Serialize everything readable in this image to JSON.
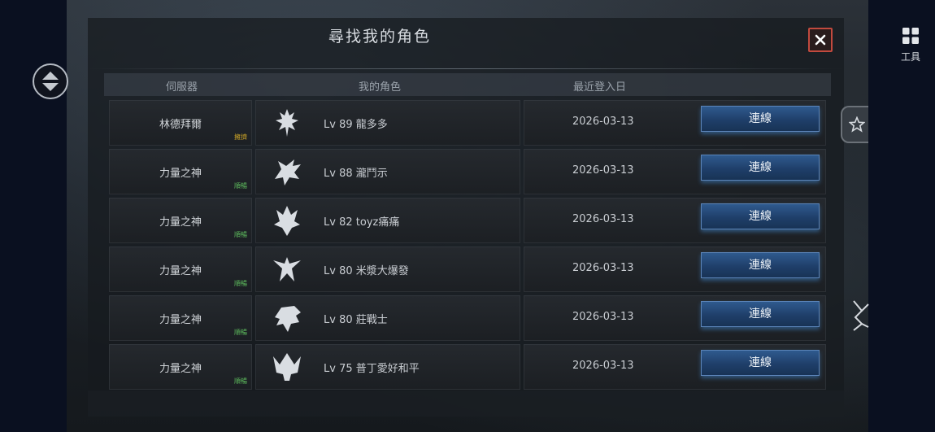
{
  "dialog": {
    "title": "尋找我的角色",
    "close_label": "close"
  },
  "table": {
    "headers": {
      "server": "伺服器",
      "character": "我的角色",
      "last_login": "最近登入日"
    },
    "rows": [
      {
        "server": "林德拜爾",
        "server_tag": "擁擠",
        "server_tag_color": "#c9a227",
        "level": "Lv 89",
        "name": "龍多多",
        "date": "2026-03-13",
        "button": "連線",
        "emblem": "spider-emblem-icon"
      },
      {
        "server": "力量之神",
        "server_tag": "順暢",
        "server_tag_color": "#5cb85c",
        "level": "Lv 88",
        "name": "瀧鬥示",
        "date": "2026-03-13",
        "button": "連線",
        "emblem": "wolf-emblem-icon"
      },
      {
        "server": "力量之神",
        "server_tag": "順暢",
        "server_tag_color": "#5cb85c",
        "level": "Lv 82",
        "name": "toyz痛痛",
        "date": "2026-03-13",
        "button": "連線",
        "emblem": "flame-emblem-icon"
      },
      {
        "server": "力量之神",
        "server_tag": "順暢",
        "server_tag_color": "#5cb85c",
        "level": "Lv 80",
        "name": "米漿大爆發",
        "date": "2026-03-13",
        "button": "連線",
        "emblem": "winged-emblem-icon"
      },
      {
        "server": "力量之神",
        "server_tag": "順暢",
        "server_tag_color": "#5cb85c",
        "level": "Lv 80",
        "name": "莊戰士",
        "date": "2026-03-13",
        "button": "連線",
        "emblem": "helmet-emblem-icon"
      },
      {
        "server": "力量之神",
        "server_tag": "順暢",
        "server_tag_color": "#5cb85c",
        "level": "Lv 75",
        "name": "普丁愛好和平",
        "date": "2026-03-13",
        "button": "連線",
        "emblem": "crown-emblem-icon"
      }
    ]
  },
  "sidebar": {
    "tools_label": "工具"
  },
  "colors": {
    "accent_button": "#1f3f6a",
    "close_border": "#c24a3e"
  }
}
